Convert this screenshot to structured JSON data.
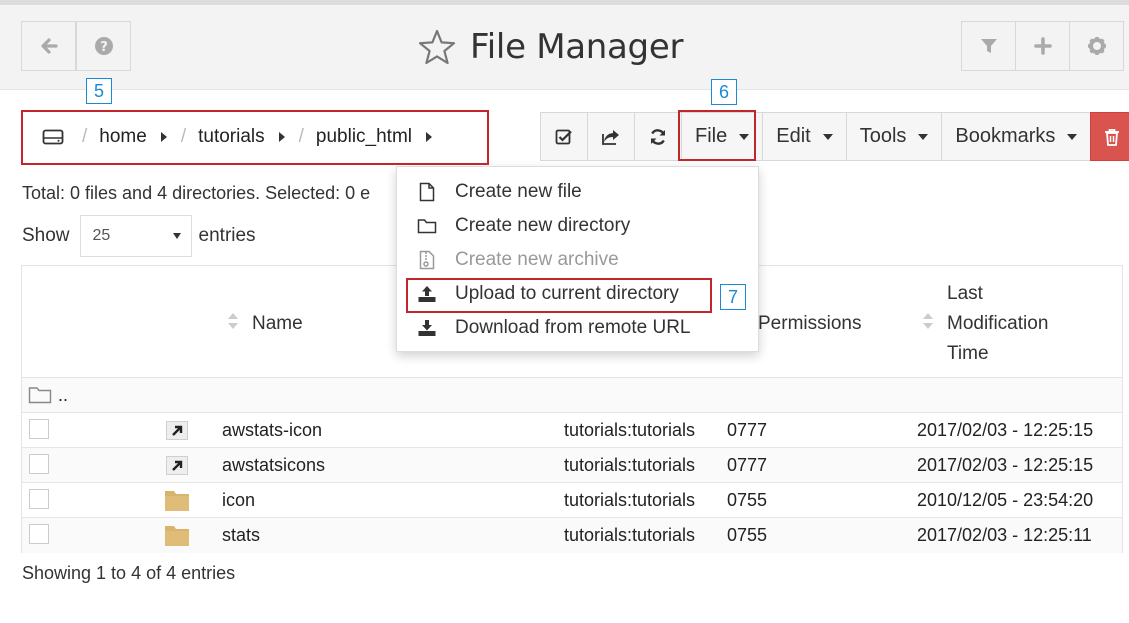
{
  "header": {
    "title": "File Manager",
    "left_buttons": [
      "back-arrow-icon",
      "help-icon"
    ],
    "right_buttons": [
      "filter-icon",
      "plus-icon",
      "gear-icon"
    ]
  },
  "annotations": {
    "n5": "5",
    "n6": "6",
    "n7": "7"
  },
  "breadcrumb": {
    "root_icon": "drive-icon",
    "separator": "/",
    "items": [
      "home",
      "tutorials",
      "public_html"
    ]
  },
  "toolbar": {
    "icons": [
      "select-all-icon",
      "share-icon",
      "refresh-icon"
    ],
    "menus": [
      "File",
      "Edit",
      "Tools",
      "Bookmarks"
    ],
    "delete_icon": "trash-icon"
  },
  "file_menu": {
    "items": [
      {
        "label": "Create new file",
        "icon": "file-icon",
        "disabled": false
      },
      {
        "label": "Create new directory",
        "icon": "folder-icon",
        "disabled": false
      },
      {
        "label": "Create new archive",
        "icon": "archive-icon",
        "disabled": true
      },
      {
        "label": "Upload to current directory",
        "icon": "upload-icon",
        "disabled": false
      },
      {
        "label": "Download from remote URL",
        "icon": "download-icon",
        "disabled": false
      }
    ]
  },
  "info": {
    "total": "Total: 0 files and 4 directories. Selected: 0 e",
    "show_label": "Show",
    "page_size": "25",
    "entries_label": "entries",
    "showing": "Showing 1 to 4 of 4 entries"
  },
  "table": {
    "headers": {
      "name": "Name",
      "permissions": "Permissions",
      "modified_line1": "Last",
      "modified_line2": "Modification",
      "modified_line3": "Time"
    },
    "parent_row": "..",
    "rows": [
      {
        "name": "awstats-icon",
        "type": "symlink",
        "owner": "tutorials:tutorials",
        "perms": "0777",
        "modified": "2017/02/03 - 12:25:15"
      },
      {
        "name": "awstatsicons",
        "type": "symlink",
        "owner": "tutorials:tutorials",
        "perms": "0777",
        "modified": "2017/02/03 - 12:25:15"
      },
      {
        "name": "icon",
        "type": "folder",
        "owner": "tutorials:tutorials",
        "perms": "0755",
        "modified": "2010/12/05 - 23:54:20"
      },
      {
        "name": "stats",
        "type": "folder",
        "owner": "tutorials:tutorials",
        "perms": "0755",
        "modified": "2017/02/03 - 12:25:11"
      }
    ]
  },
  "colors": {
    "annotation_red": "#c0262b",
    "annotation_blue": "#1a8ad4",
    "delete_button": "#d9534f",
    "folder": "#d8b36a"
  }
}
